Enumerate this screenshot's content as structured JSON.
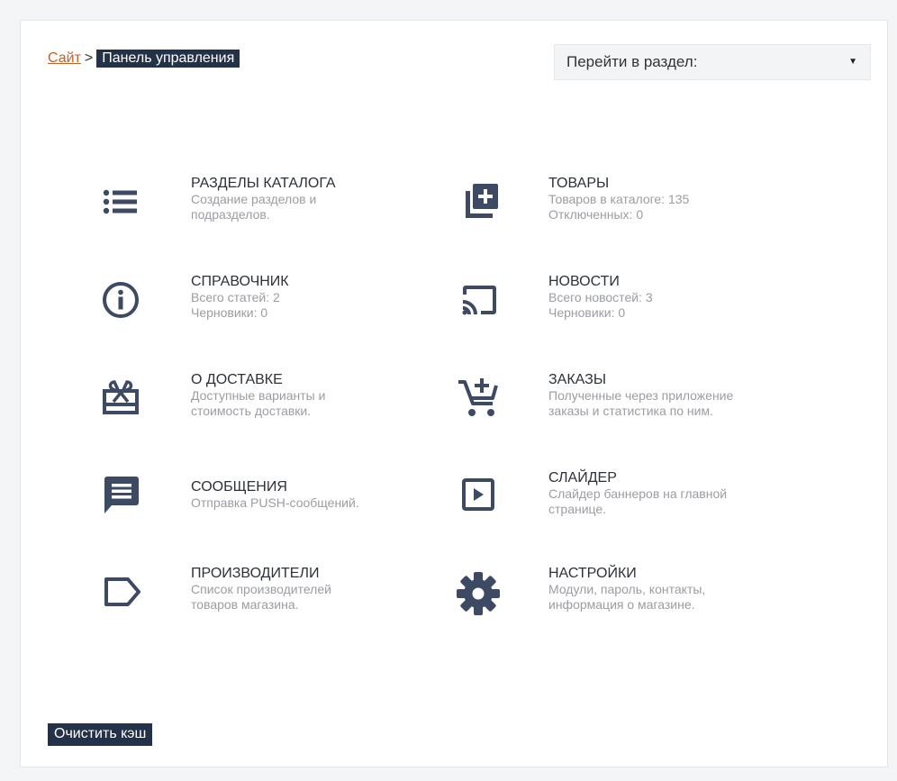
{
  "breadcrumb": {
    "home": "Сайт",
    "separator": ">",
    "current": "Панель управления"
  },
  "section_select": {
    "value": "Перейти в раздел:",
    "arrow": "▼"
  },
  "tiles": [
    {
      "icon": "list-icon",
      "title": "РАЗДЕЛЫ КАТАЛОГА",
      "line1": "Создание разделов и",
      "line2": "подразделов."
    },
    {
      "icon": "add-library-icon",
      "title": "ТОВАРЫ",
      "line1": "Товаров в каталоге: 135",
      "line2": "Отключенных: 0"
    },
    {
      "icon": "info-icon",
      "title": "СПРАВОЧНИК",
      "line1": "Всего статей: 2",
      "line2": "Черновики: 0"
    },
    {
      "icon": "cast-icon",
      "title": "НОВОСТИ",
      "line1": "Всего новостей: 3",
      "line2": "Черновики: 0"
    },
    {
      "icon": "gift-card-icon",
      "title": "О ДОСТАВКЕ",
      "line1": "Доступные варианты и",
      "line2": "стоимость доставки."
    },
    {
      "icon": "cart-add-icon",
      "title": "ЗАКАЗЫ",
      "line1": "Полученные через приложение",
      "line2": "заказы и статистика по ним."
    },
    {
      "icon": "message-icon",
      "title": "СООБЩЕНИЯ",
      "line1": "Отправка PUSH-сообщений.",
      "line2": ""
    },
    {
      "icon": "slideshow-icon",
      "title": "СЛАЙДЕР",
      "line1": "Слайдер баннеров на главной",
      "line2": "странице."
    },
    {
      "icon": "label-icon",
      "title": "ПРОИЗВОДИТЕЛИ",
      "line1": "Список производителей",
      "line2": "товаров магазина."
    },
    {
      "icon": "gear-icon",
      "title": "НАСТРОЙКИ",
      "line1": "Модули, пароль, контакты,",
      "line2": "информация о магазине."
    }
  ],
  "clear_cache_label": "Очистить кэш",
  "colors": {
    "icon": "#3d4a63",
    "accent_dark": "#243249",
    "link": "#c0622a",
    "muted_text": "#9a9da2"
  }
}
